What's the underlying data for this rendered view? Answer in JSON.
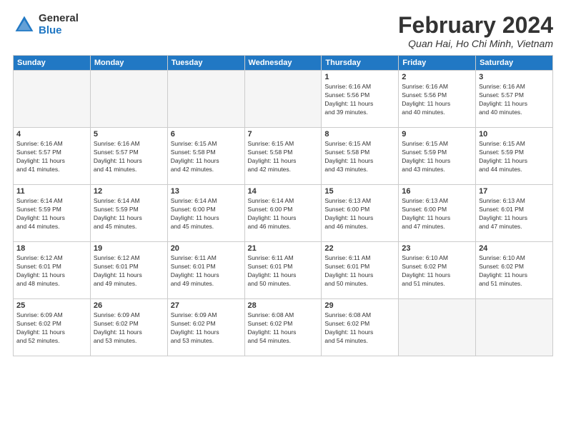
{
  "header": {
    "logo_general": "General",
    "logo_blue": "Blue",
    "month_title": "February 2024",
    "location": "Quan Hai, Ho Chi Minh, Vietnam"
  },
  "weekdays": [
    "Sunday",
    "Monday",
    "Tuesday",
    "Wednesday",
    "Thursday",
    "Friday",
    "Saturday"
  ],
  "weeks": [
    [
      {
        "day": "",
        "info": ""
      },
      {
        "day": "",
        "info": ""
      },
      {
        "day": "",
        "info": ""
      },
      {
        "day": "",
        "info": ""
      },
      {
        "day": "1",
        "info": "Sunrise: 6:16 AM\nSunset: 5:56 PM\nDaylight: 11 hours\nand 39 minutes."
      },
      {
        "day": "2",
        "info": "Sunrise: 6:16 AM\nSunset: 5:56 PM\nDaylight: 11 hours\nand 40 minutes."
      },
      {
        "day": "3",
        "info": "Sunrise: 6:16 AM\nSunset: 5:57 PM\nDaylight: 11 hours\nand 40 minutes."
      }
    ],
    [
      {
        "day": "4",
        "info": "Sunrise: 6:16 AM\nSunset: 5:57 PM\nDaylight: 11 hours\nand 41 minutes."
      },
      {
        "day": "5",
        "info": "Sunrise: 6:16 AM\nSunset: 5:57 PM\nDaylight: 11 hours\nand 41 minutes."
      },
      {
        "day": "6",
        "info": "Sunrise: 6:15 AM\nSunset: 5:58 PM\nDaylight: 11 hours\nand 42 minutes."
      },
      {
        "day": "7",
        "info": "Sunrise: 6:15 AM\nSunset: 5:58 PM\nDaylight: 11 hours\nand 42 minutes."
      },
      {
        "day": "8",
        "info": "Sunrise: 6:15 AM\nSunset: 5:58 PM\nDaylight: 11 hours\nand 43 minutes."
      },
      {
        "day": "9",
        "info": "Sunrise: 6:15 AM\nSunset: 5:59 PM\nDaylight: 11 hours\nand 43 minutes."
      },
      {
        "day": "10",
        "info": "Sunrise: 6:15 AM\nSunset: 5:59 PM\nDaylight: 11 hours\nand 44 minutes."
      }
    ],
    [
      {
        "day": "11",
        "info": "Sunrise: 6:14 AM\nSunset: 5:59 PM\nDaylight: 11 hours\nand 44 minutes."
      },
      {
        "day": "12",
        "info": "Sunrise: 6:14 AM\nSunset: 5:59 PM\nDaylight: 11 hours\nand 45 minutes."
      },
      {
        "day": "13",
        "info": "Sunrise: 6:14 AM\nSunset: 6:00 PM\nDaylight: 11 hours\nand 45 minutes."
      },
      {
        "day": "14",
        "info": "Sunrise: 6:14 AM\nSunset: 6:00 PM\nDaylight: 11 hours\nand 46 minutes."
      },
      {
        "day": "15",
        "info": "Sunrise: 6:13 AM\nSunset: 6:00 PM\nDaylight: 11 hours\nand 46 minutes."
      },
      {
        "day": "16",
        "info": "Sunrise: 6:13 AM\nSunset: 6:00 PM\nDaylight: 11 hours\nand 47 minutes."
      },
      {
        "day": "17",
        "info": "Sunrise: 6:13 AM\nSunset: 6:01 PM\nDaylight: 11 hours\nand 47 minutes."
      }
    ],
    [
      {
        "day": "18",
        "info": "Sunrise: 6:12 AM\nSunset: 6:01 PM\nDaylight: 11 hours\nand 48 minutes."
      },
      {
        "day": "19",
        "info": "Sunrise: 6:12 AM\nSunset: 6:01 PM\nDaylight: 11 hours\nand 49 minutes."
      },
      {
        "day": "20",
        "info": "Sunrise: 6:11 AM\nSunset: 6:01 PM\nDaylight: 11 hours\nand 49 minutes."
      },
      {
        "day": "21",
        "info": "Sunrise: 6:11 AM\nSunset: 6:01 PM\nDaylight: 11 hours\nand 50 minutes."
      },
      {
        "day": "22",
        "info": "Sunrise: 6:11 AM\nSunset: 6:01 PM\nDaylight: 11 hours\nand 50 minutes."
      },
      {
        "day": "23",
        "info": "Sunrise: 6:10 AM\nSunset: 6:02 PM\nDaylight: 11 hours\nand 51 minutes."
      },
      {
        "day": "24",
        "info": "Sunrise: 6:10 AM\nSunset: 6:02 PM\nDaylight: 11 hours\nand 51 minutes."
      }
    ],
    [
      {
        "day": "25",
        "info": "Sunrise: 6:09 AM\nSunset: 6:02 PM\nDaylight: 11 hours\nand 52 minutes."
      },
      {
        "day": "26",
        "info": "Sunrise: 6:09 AM\nSunset: 6:02 PM\nDaylight: 11 hours\nand 53 minutes."
      },
      {
        "day": "27",
        "info": "Sunrise: 6:09 AM\nSunset: 6:02 PM\nDaylight: 11 hours\nand 53 minutes."
      },
      {
        "day": "28",
        "info": "Sunrise: 6:08 AM\nSunset: 6:02 PM\nDaylight: 11 hours\nand 54 minutes."
      },
      {
        "day": "29",
        "info": "Sunrise: 6:08 AM\nSunset: 6:02 PM\nDaylight: 11 hours\nand 54 minutes."
      },
      {
        "day": "",
        "info": ""
      },
      {
        "day": "",
        "info": ""
      }
    ]
  ]
}
